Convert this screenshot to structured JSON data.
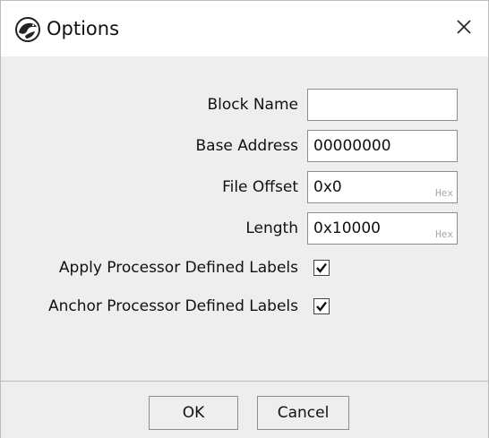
{
  "window": {
    "title": "Options",
    "icon": "dragon-logo-icon",
    "close_glyph": "✕"
  },
  "form": {
    "block_name": {
      "label": "Block Name",
      "value": ""
    },
    "base_address": {
      "label": "Base Address",
      "value": "00000000"
    },
    "file_offset": {
      "label": "File Offset",
      "value": "0x0",
      "suffix": "Hex"
    },
    "length": {
      "label": "Length",
      "value": "0x10000",
      "suffix": "Hex"
    },
    "apply_labels": {
      "label": "Apply Processor Defined Labels",
      "checked": true
    },
    "anchor_labels": {
      "label": "Anchor Processor Defined Labels",
      "checked": true
    }
  },
  "buttons": {
    "ok_label": "OK",
    "cancel_label": "Cancel"
  }
}
